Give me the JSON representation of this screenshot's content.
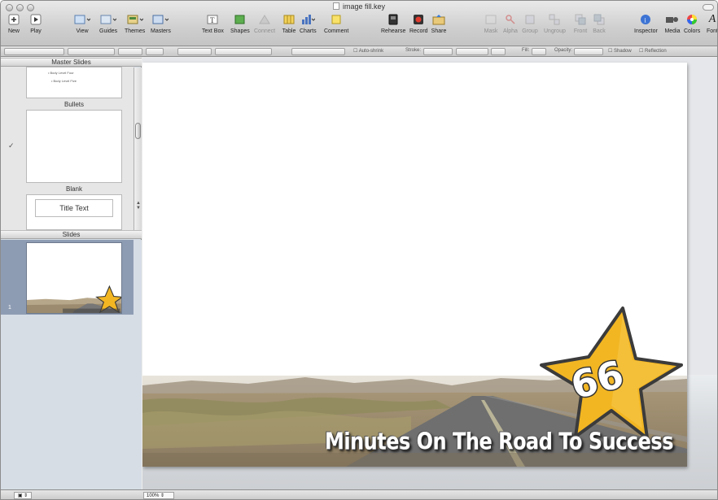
{
  "window": {
    "title": "image fill.key"
  },
  "toolbar": [
    {
      "id": "new",
      "label": "New",
      "icon": "plus-icon",
      "enabled": true
    },
    {
      "id": "play",
      "label": "Play",
      "icon": "play-icon",
      "enabled": true
    },
    {
      "id": "view",
      "label": "View",
      "icon": "view-icon",
      "enabled": true
    },
    {
      "id": "guides",
      "label": "Guides",
      "icon": "guides-icon",
      "enabled": true
    },
    {
      "id": "themes",
      "label": "Themes",
      "icon": "themes-icon",
      "enabled": true
    },
    {
      "id": "masters",
      "label": "Masters",
      "icon": "masters-icon",
      "enabled": true
    },
    {
      "id": "textbox",
      "label": "Text Box",
      "icon": "textbox-icon",
      "enabled": true
    },
    {
      "id": "shapes",
      "label": "Shapes",
      "icon": "shapes-icon",
      "enabled": true
    },
    {
      "id": "connect",
      "label": "Connect",
      "icon": "connect-icon",
      "enabled": false
    },
    {
      "id": "table",
      "label": "Table",
      "icon": "table-icon",
      "enabled": true
    },
    {
      "id": "charts",
      "label": "Charts",
      "icon": "charts-icon",
      "enabled": true
    },
    {
      "id": "comment",
      "label": "Comment",
      "icon": "comment-icon",
      "enabled": true
    },
    {
      "id": "rehearse",
      "label": "Rehearse",
      "icon": "rehearse-icon",
      "enabled": true
    },
    {
      "id": "record",
      "label": "Record",
      "icon": "record-icon",
      "enabled": true
    },
    {
      "id": "share",
      "label": "Share",
      "icon": "share-icon",
      "enabled": true
    },
    {
      "id": "mask",
      "label": "Mask",
      "icon": "mask-icon",
      "enabled": false
    },
    {
      "id": "alpha",
      "label": "Alpha",
      "icon": "alpha-icon",
      "enabled": false
    },
    {
      "id": "group",
      "label": "Group",
      "icon": "group-icon",
      "enabled": false
    },
    {
      "id": "ungroup",
      "label": "Ungroup",
      "icon": "ungroup-icon",
      "enabled": false
    },
    {
      "id": "front",
      "label": "Front",
      "icon": "front-icon",
      "enabled": false
    },
    {
      "id": "back",
      "label": "Back",
      "icon": "back-icon",
      "enabled": false
    },
    {
      "id": "inspector",
      "label": "Inspector",
      "icon": "info-icon",
      "enabled": true
    },
    {
      "id": "media",
      "label": "Media",
      "icon": "media-icon",
      "enabled": true
    },
    {
      "id": "colors",
      "label": "Colors",
      "icon": "colors-icon",
      "enabled": true
    },
    {
      "id": "fonts",
      "label": "Font",
      "icon": "fonts-icon",
      "enabled": true
    }
  ],
  "formatbar": {
    "autoshrink": "Auto-shrink",
    "stroke": "Stroke:",
    "fill": "Fill:",
    "opacity": "Opacity:",
    "shadow": "Shadow",
    "reflection": "Reflection"
  },
  "sidebar": {
    "masters_header": "Master Slides",
    "master_items": [
      {
        "label": "",
        "lines": [
          "Body Level Four",
          "Body Level Five"
        ]
      },
      {
        "label": "Bullets",
        "checked": true
      },
      {
        "label": "Blank",
        "title_text": "Title Text"
      }
    ],
    "slides_header": "Slides",
    "slides": [
      {
        "number": "1"
      }
    ]
  },
  "slide": {
    "caption": "Minutes On The Road To Success",
    "badge": "66"
  },
  "status": {
    "zoom": "100%"
  },
  "colors": {
    "star_fill": "#f2b623",
    "star_stroke": "#3b3b3b",
    "selected_row": "#8e9cb3"
  }
}
